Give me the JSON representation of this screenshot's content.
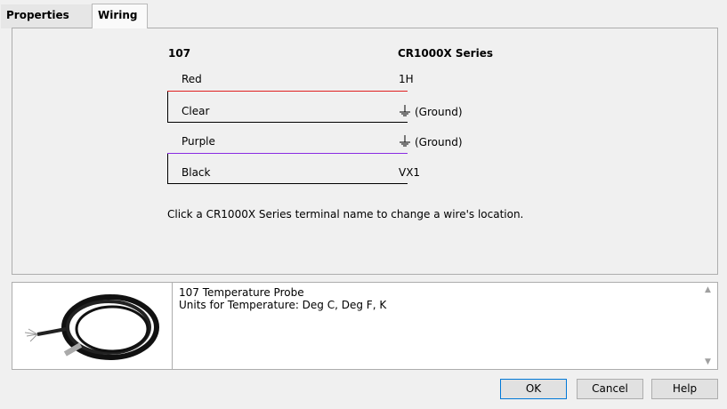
{
  "tabs": [
    {
      "label": "Properties"
    },
    {
      "label": "Wiring"
    }
  ],
  "wiring": {
    "sensor_header": "107",
    "logger_header": "CR1000X Series",
    "rows": [
      {
        "wire": "Red",
        "terminal": "1H",
        "color": "#e02020"
      },
      {
        "wire": "Clear",
        "terminal": "(Ground)",
        "color": "#000000"
      },
      {
        "wire": "Purple",
        "terminal": "(Ground)",
        "color": "#8a2be2"
      },
      {
        "wire": "Black",
        "terminal": "VX1",
        "color": "#000000"
      }
    ],
    "hint": "Click a CR1000X Series terminal name to change a wire's location."
  },
  "description": {
    "line1": "107 Temperature Probe",
    "line2": "Units for Temperature: Deg C, Deg F, K"
  },
  "buttons": {
    "ok": "OK",
    "cancel": "Cancel",
    "help": "Help"
  },
  "icons": {
    "ground": "ground-symbol-icon",
    "scroll_up": "chevron-up-icon",
    "scroll_down": "chevron-down-icon"
  }
}
